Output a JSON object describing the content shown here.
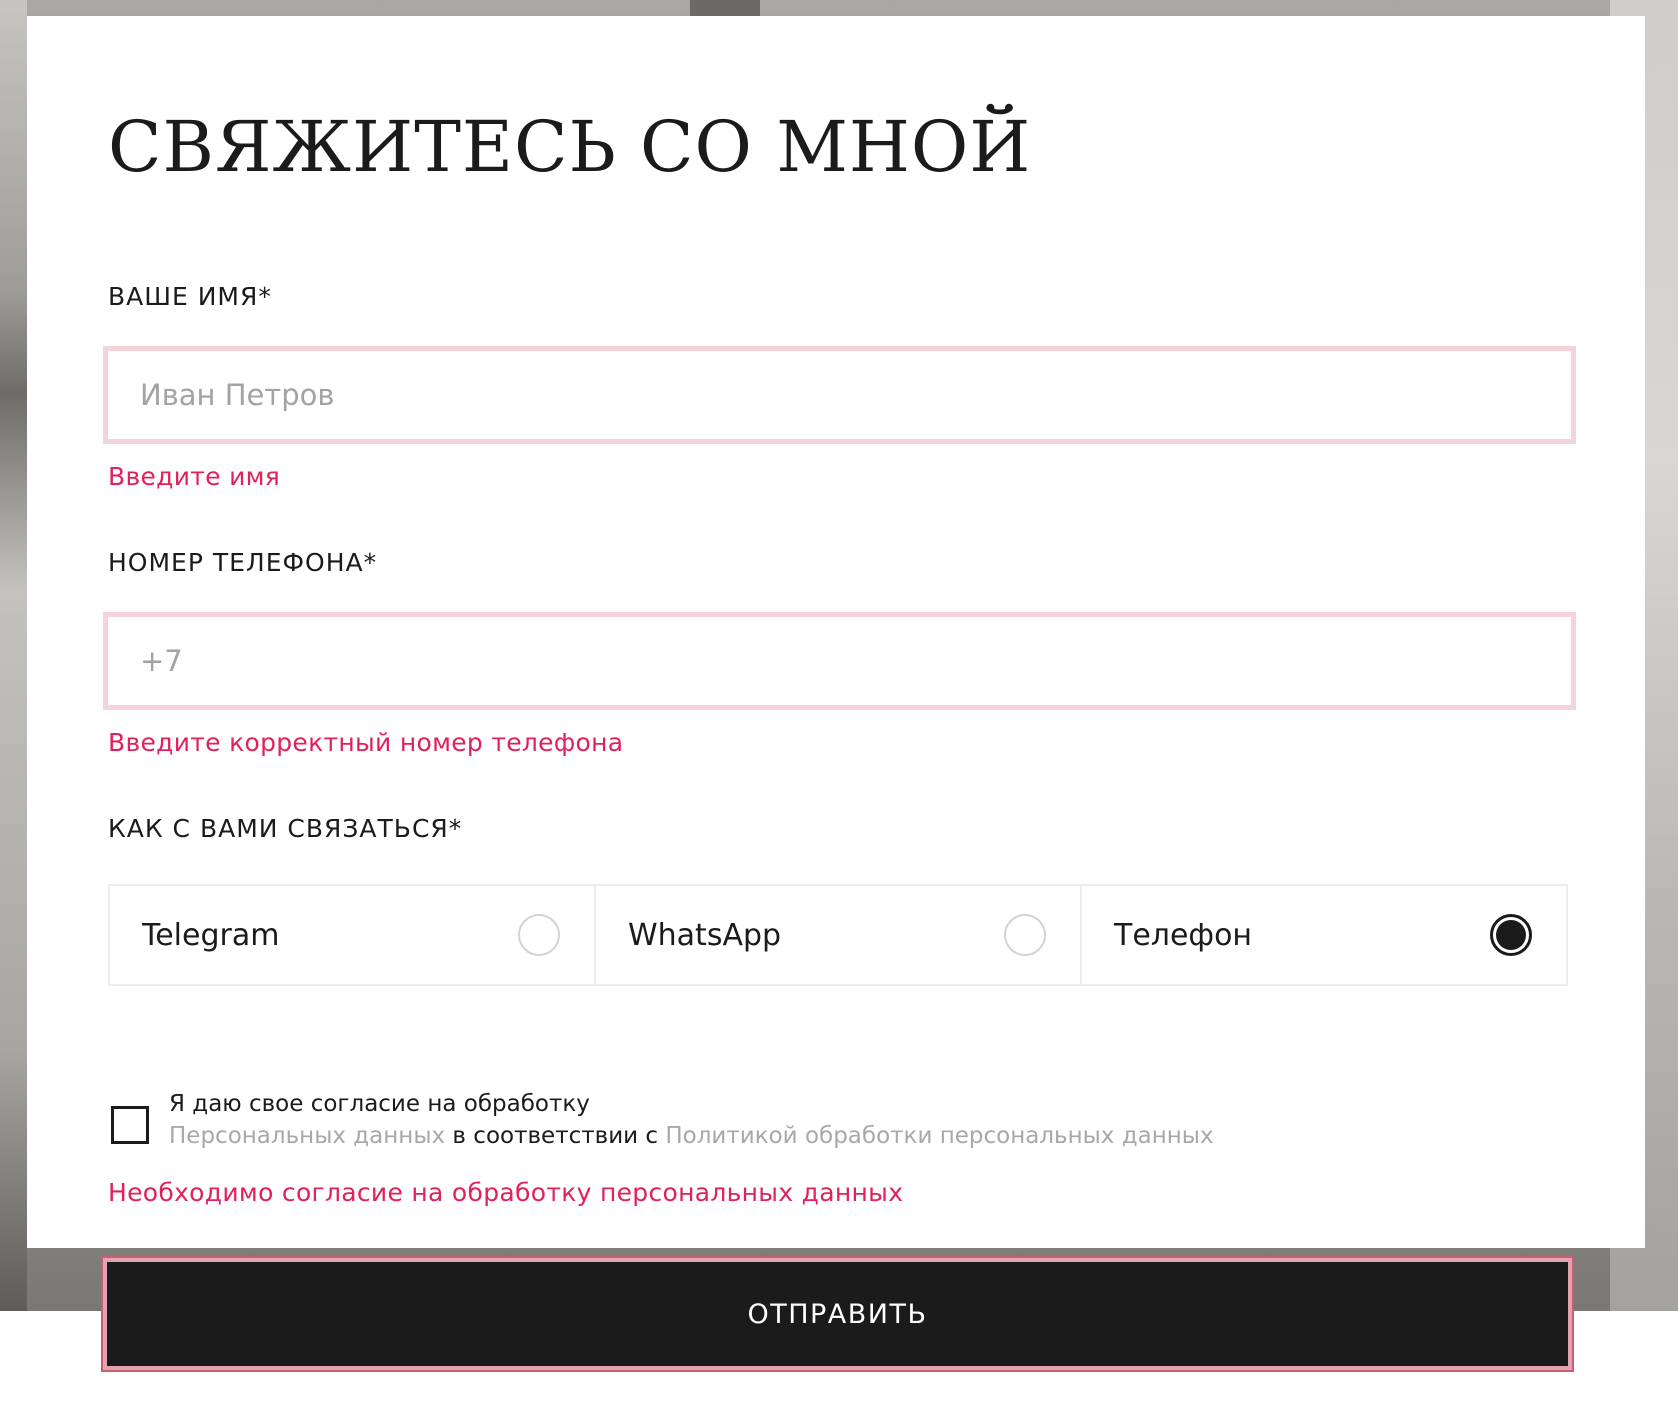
{
  "form": {
    "title": "СВЯЖИТЕСЬ СО МНОЙ",
    "name": {
      "label": "ВАШЕ ИМЯ*",
      "placeholder": "Иван Петров",
      "value": "",
      "error": "Введите имя"
    },
    "phone": {
      "label": "НОМЕР ТЕЛЕФОНА*",
      "placeholder": "+7",
      "value": "",
      "error": "Введите корректный номер телефона"
    },
    "contact_method": {
      "label": "КАК С ВАМИ СВЯЗАТЬСЯ*",
      "options": [
        {
          "label": "Telegram",
          "selected": false
        },
        {
          "label": "WhatsApp",
          "selected": false
        },
        {
          "label": "Телефон",
          "selected": true
        }
      ]
    },
    "consent": {
      "checked": false,
      "text_line1": "Я даю свое согласие на обработку",
      "link1": "Персональных данных",
      "middle": " в соответствии с ",
      "link2": "Политикой обработки персональных данных",
      "error": "Необходимо согласие на обработку персональных данных"
    },
    "submit_label": "ОТПРАВИТЬ"
  },
  "colors": {
    "error": "#e0215a",
    "field_error_border": "#f5d3db",
    "submit_bg": "#1b1b1b",
    "link_muted": "#a8a8a8"
  }
}
